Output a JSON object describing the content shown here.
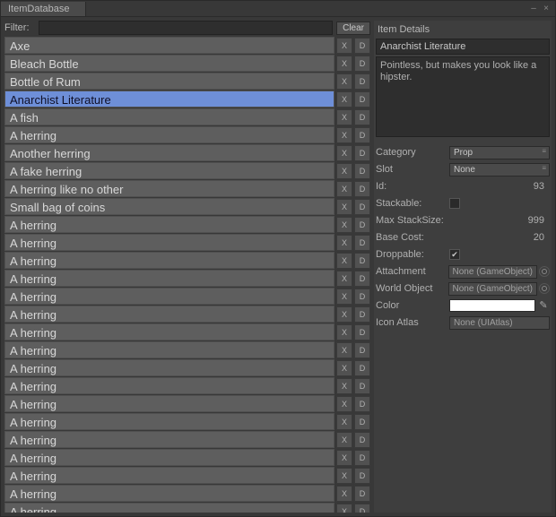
{
  "window": {
    "title": "ItemDatabase"
  },
  "filter": {
    "label": "Filter:",
    "value": "",
    "clear": "Clear"
  },
  "items": [
    {
      "name": "Axe",
      "selected": false
    },
    {
      "name": "Bleach Bottle",
      "selected": false
    },
    {
      "name": "Bottle of Rum",
      "selected": false
    },
    {
      "name": "Anarchist Literature",
      "selected": true
    },
    {
      "name": "A fish",
      "selected": false
    },
    {
      "name": "A herring",
      "selected": false
    },
    {
      "name": "Another herring",
      "selected": false
    },
    {
      "name": "A fake herring",
      "selected": false
    },
    {
      "name": "A herring like no other",
      "selected": false
    },
    {
      "name": "Small bag of coins",
      "selected": false
    },
    {
      "name": "A herring",
      "selected": false
    },
    {
      "name": "A herring",
      "selected": false
    },
    {
      "name": "A herring",
      "selected": false
    },
    {
      "name": "A herring",
      "selected": false
    },
    {
      "name": "A herring",
      "selected": false
    },
    {
      "name": "A herring",
      "selected": false
    },
    {
      "name": "A herring",
      "selected": false
    },
    {
      "name": "A herring",
      "selected": false
    },
    {
      "name": "A herring",
      "selected": false
    },
    {
      "name": "A herring",
      "selected": false
    },
    {
      "name": "A herring",
      "selected": false
    },
    {
      "name": "A herring",
      "selected": false
    },
    {
      "name": "A herring",
      "selected": false
    },
    {
      "name": "A herring",
      "selected": false
    },
    {
      "name": "A herring",
      "selected": false
    },
    {
      "name": "A herring",
      "selected": false
    },
    {
      "name": "A herring",
      "selected": false
    }
  ],
  "row_buttons": {
    "delete": "X",
    "duplicate": "D"
  },
  "details": {
    "header": "Item Details",
    "name": "Anarchist Literature",
    "description": "Pointless, but makes you look like a hipster.",
    "fields": {
      "category": {
        "label": "Category",
        "value": "Prop"
      },
      "slot": {
        "label": "Slot",
        "value": "None"
      },
      "id": {
        "label": "Id:",
        "value": "93"
      },
      "stackable": {
        "label": "Stackable:",
        "checked": false
      },
      "maxstack": {
        "label": "Max StackSize:",
        "value": "999"
      },
      "basecost": {
        "label": "Base Cost:",
        "value": "20"
      },
      "droppable": {
        "label": "Droppable:",
        "checked": true
      },
      "attachment": {
        "label": "Attachment",
        "value": "None (GameObject)"
      },
      "worldobj": {
        "label": "World Object",
        "value": "None (GameObject)"
      },
      "color": {
        "label": "Color",
        "value": "#ffffff"
      },
      "iconatlas": {
        "label": "Icon Atlas",
        "value": "None (UIAtlas)"
      }
    }
  }
}
